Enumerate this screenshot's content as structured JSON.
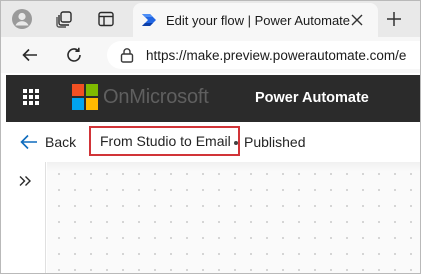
{
  "browser": {
    "tab": {
      "title": "Edit your flow | Power Automate",
      "favicon": "power-automate-icon"
    },
    "address_bar": {
      "url": "https://make.preview.powerautomate.com/e"
    }
  },
  "app_header": {
    "org_name": "OnMicrosoft",
    "app_name": "Power Automate",
    "logo_colors": [
      "#f25022",
      "#7fba00",
      "#00a4ef",
      "#ffb900"
    ]
  },
  "command_bar": {
    "back_label": "Back",
    "flow_name": "From Studio to Email",
    "status": "Published"
  },
  "colors": {
    "appbar_bg": "#2b2b2b",
    "accent": "#0f6cbd",
    "highlight_border": "#d13438"
  }
}
